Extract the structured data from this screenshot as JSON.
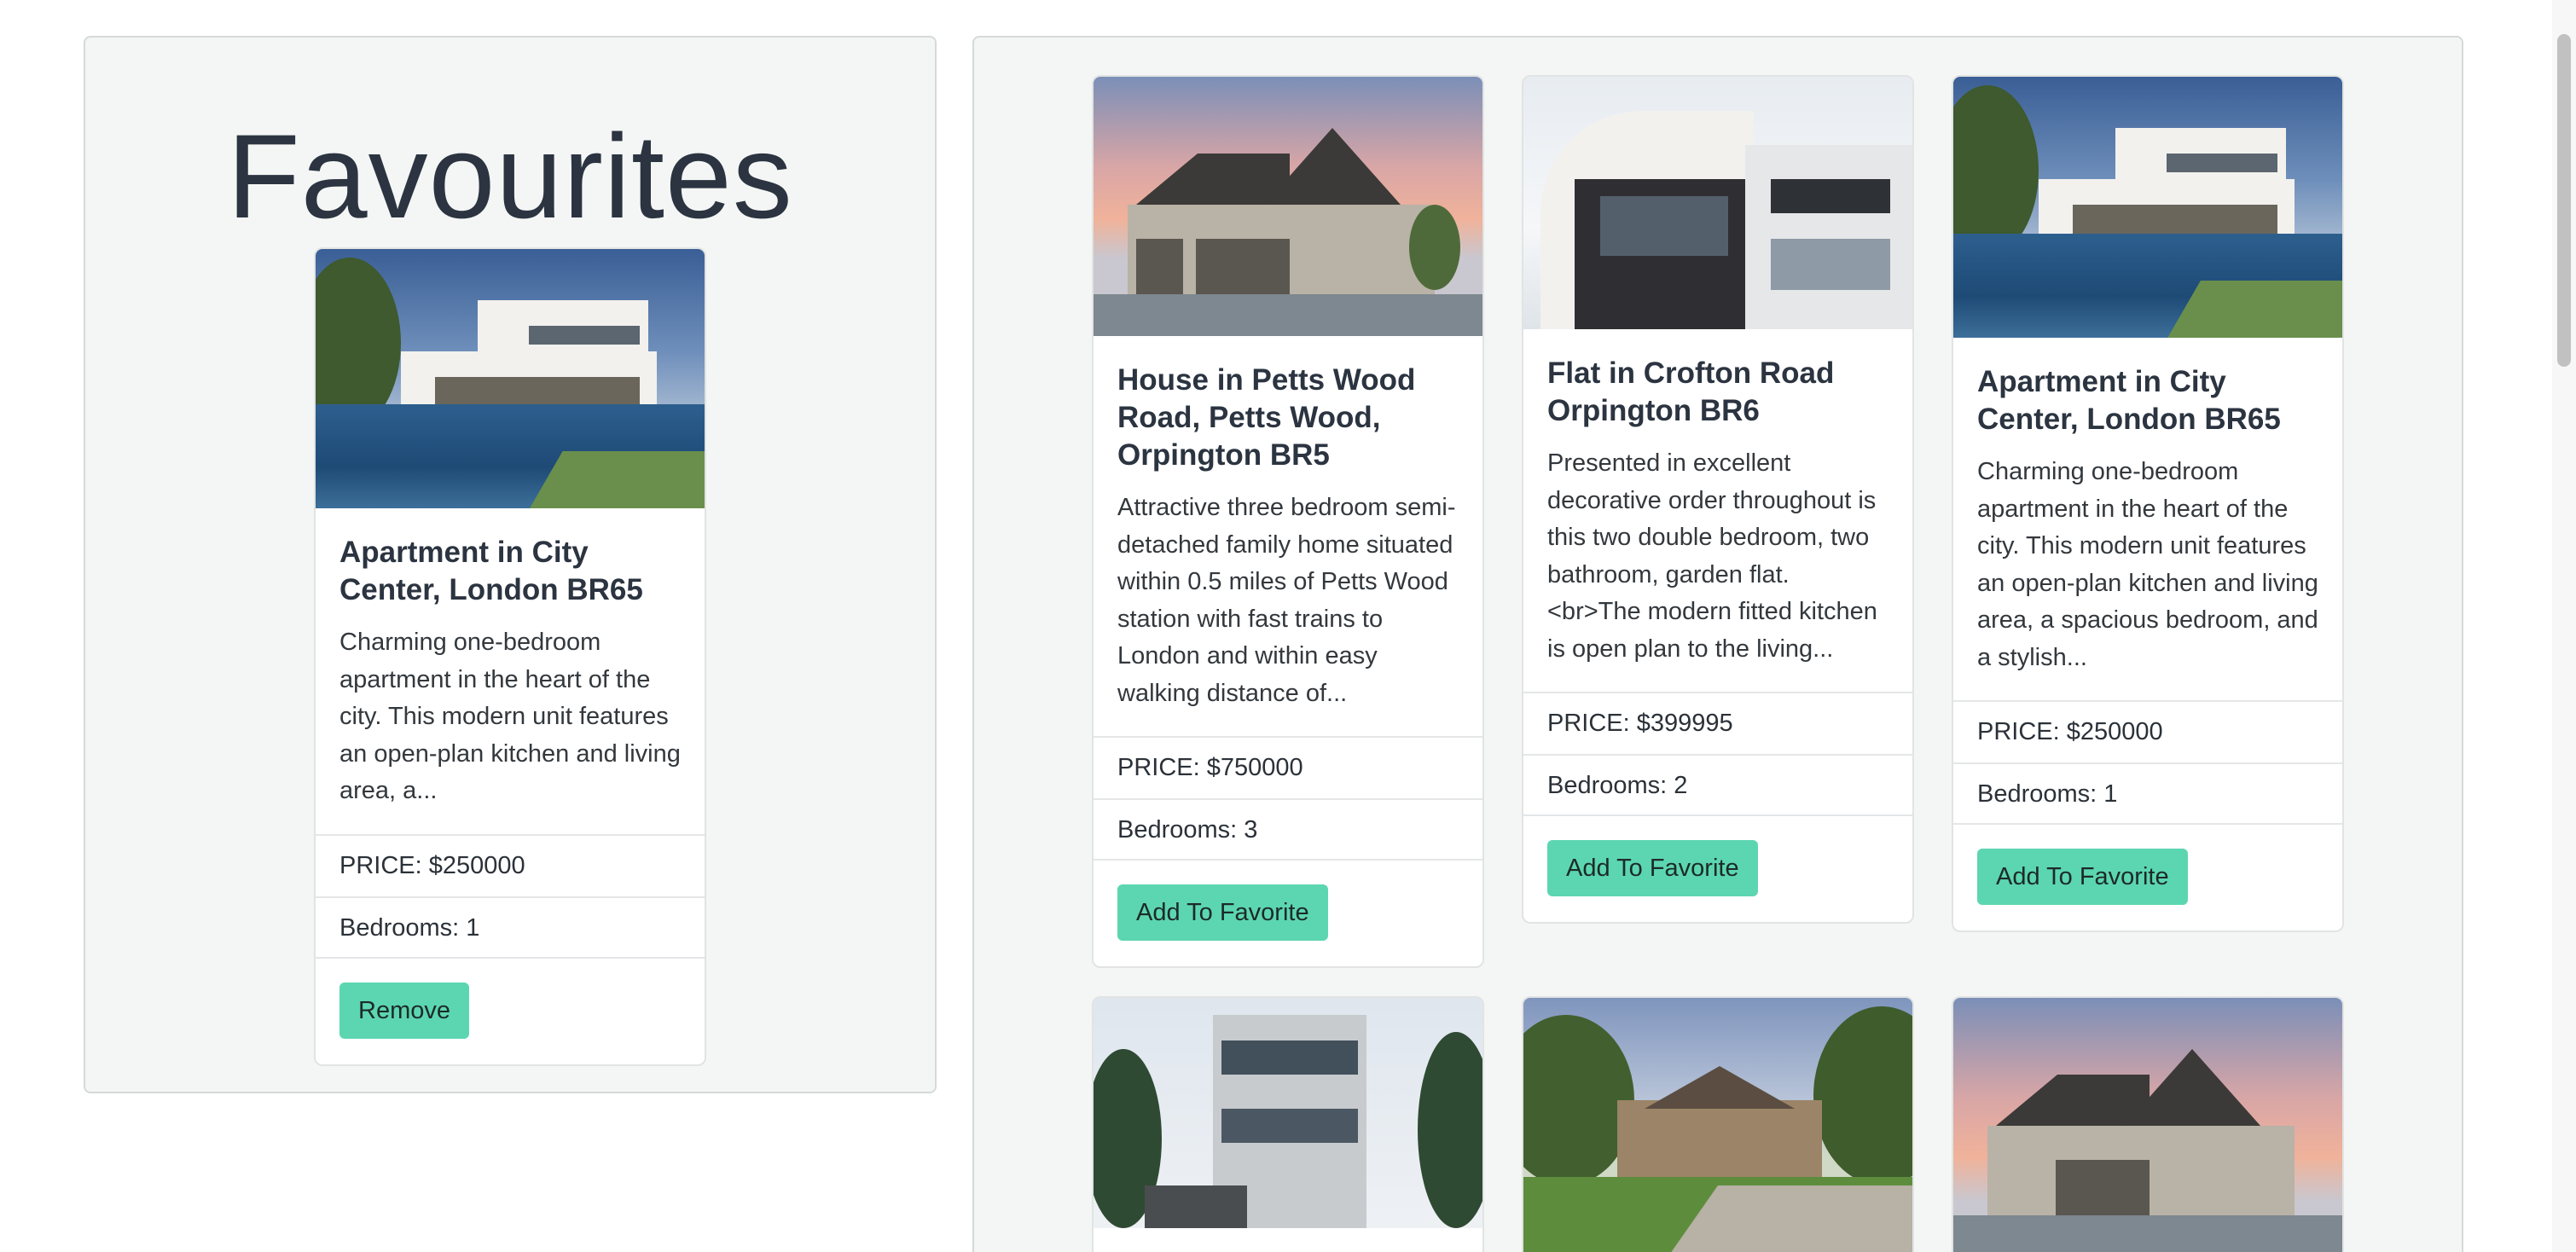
{
  "favourites": {
    "title": "Favourites",
    "card": {
      "image": "modern-white-villa-with-pool",
      "title": "Apartment in City Center, London BR65",
      "description": "Charming one-bedroom apartment in the heart of the city. This modern unit features an open-plan kitchen and living area, a...",
      "price": "PRICE: $250000",
      "bedrooms": "Bedrooms: 1",
      "button": "Remove"
    }
  },
  "listings": [
    {
      "image": "suburban-house-sunset",
      "title": "House in Petts Wood Road, Petts Wood, Orpington BR5",
      "description": "Attractive three bedroom semi-detached family home situated within 0.5 miles of Petts Wood station with fast trains to London and within easy walking distance of...",
      "price": "PRICE: $750000",
      "bedrooms": "Bedrooms: 3",
      "button": "Add To Favorite"
    },
    {
      "image": "modern-flat-building",
      "title": "Flat in Crofton Road Orpington BR6",
      "description": "Presented in excellent decorative order throughout is this two double bedroom, two bathroom, garden flat. <br>The modern fitted kitchen is open plan to the living...",
      "price": "PRICE: $399995",
      "bedrooms": "Bedrooms: 2",
      "button": "Add To Favorite"
    },
    {
      "image": "modern-white-villa-with-pool",
      "title": "Apartment in City Center, London BR65",
      "description": "Charming one-bedroom apartment in the heart of the city. This modern unit features an open-plan kitchen and living area, a spacious bedroom, and a stylish...",
      "price": "PRICE: $250000",
      "bedrooms": "Bedrooms: 1",
      "button": "Add To Favorite"
    }
  ],
  "next_row_images": [
    "modern-glass-townhouse",
    "stone-country-house",
    "suburban-house-sunset"
  ],
  "colors": {
    "button_bg": "#5cd6b1",
    "panel_bg": "#f4f6f5",
    "title_text": "#2b3440"
  }
}
